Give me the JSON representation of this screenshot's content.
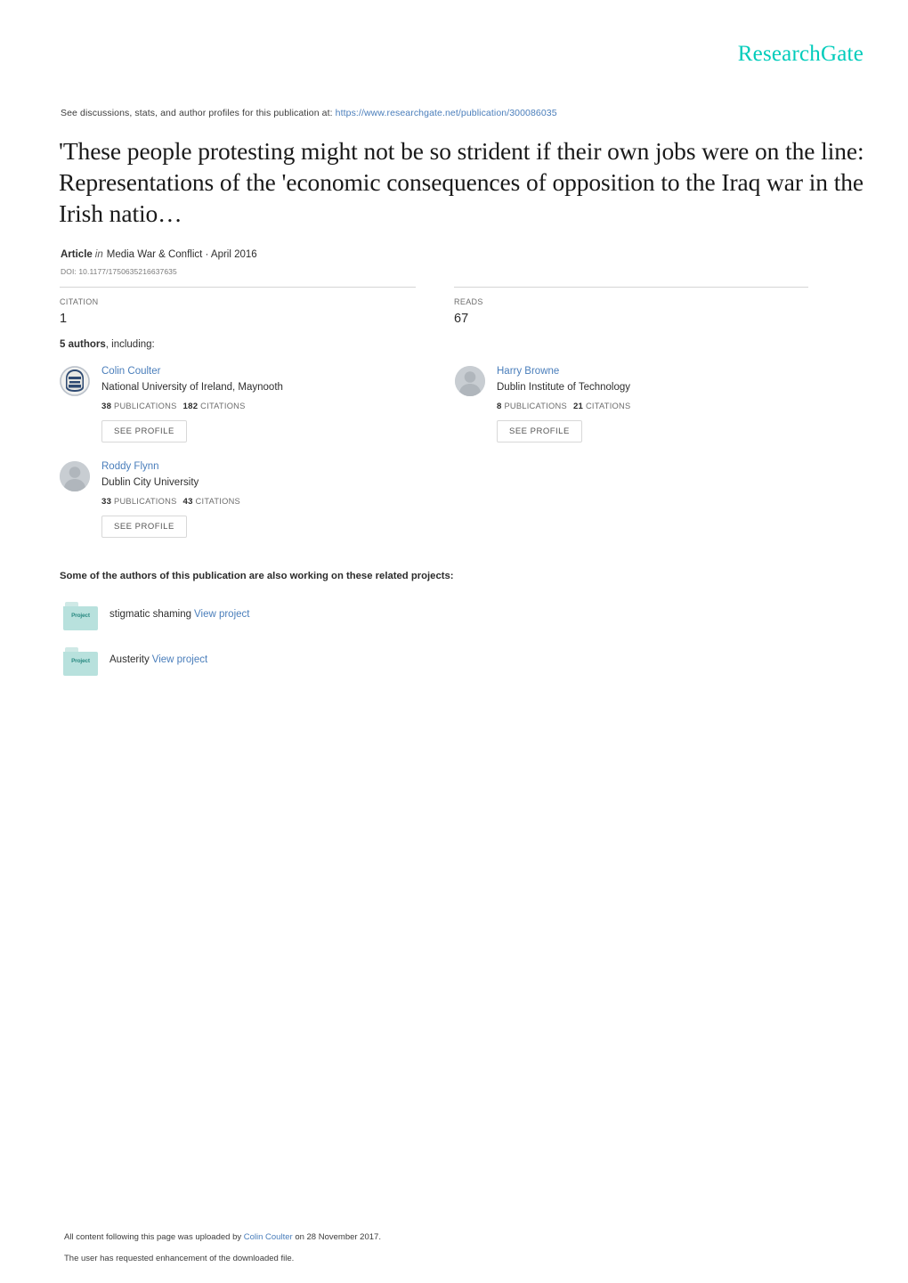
{
  "brand": {
    "name": "ResearchGate",
    "color": "#00ccbb"
  },
  "discussions": {
    "prefix": "See discussions, stats, and author profiles for this publication at:",
    "url": "https://www.researchgate.net/publication/300086035"
  },
  "publication": {
    "title": "'These people protesting might not be so strident if their own jobs were on the line: Representations of the 'economic consequences of opposition to the Iraq war in the Irish natio…",
    "type": "Article",
    "in_word": "in",
    "journal": "Media War & Conflict · April 2016",
    "doi": "DOI: 10.1177/1750635216637635"
  },
  "stats": {
    "citation": {
      "label": "CITATION",
      "value": "1"
    },
    "reads": {
      "label": "READS",
      "value": "67"
    }
  },
  "authors_header": {
    "count": "5 authors",
    "suffix": ", including:"
  },
  "authors": [
    {
      "name": "Colin Coulter",
      "affiliation": "National University of Ireland, Maynooth",
      "publications_count": "38",
      "publications_label": "PUBLICATIONS",
      "citations_count": "182",
      "citations_label": "CITATIONS",
      "button_label": "SEE PROFILE",
      "avatar_type": "crest"
    },
    {
      "name": "Harry Browne",
      "affiliation": "Dublin Institute of Technology",
      "publications_count": "8",
      "publications_label": "PUBLICATIONS",
      "citations_count": "21",
      "citations_label": "CITATIONS",
      "button_label": "SEE PROFILE",
      "avatar_type": "silhouette"
    },
    {
      "name": "Roddy Flynn",
      "affiliation": "Dublin City University",
      "publications_count": "33",
      "publications_label": "PUBLICATIONS",
      "citations_count": "43",
      "citations_label": "CITATIONS",
      "button_label": "SEE PROFILE",
      "avatar_type": "silhouette"
    }
  ],
  "projects": {
    "header": "Some of the authors of this publication are also working on these related projects:",
    "folder_label": "Project",
    "items": [
      {
        "name": "stigmatic shaming",
        "link_label": "View project"
      },
      {
        "name": "Austerity",
        "link_label": "View project"
      }
    ]
  },
  "footer": {
    "line1_prefix": "All content following this page was uploaded by",
    "line1_link": "Colin Coulter",
    "line1_suffix": "on 28 November 2017.",
    "line2": "The user has requested enhancement of the downloaded file."
  }
}
